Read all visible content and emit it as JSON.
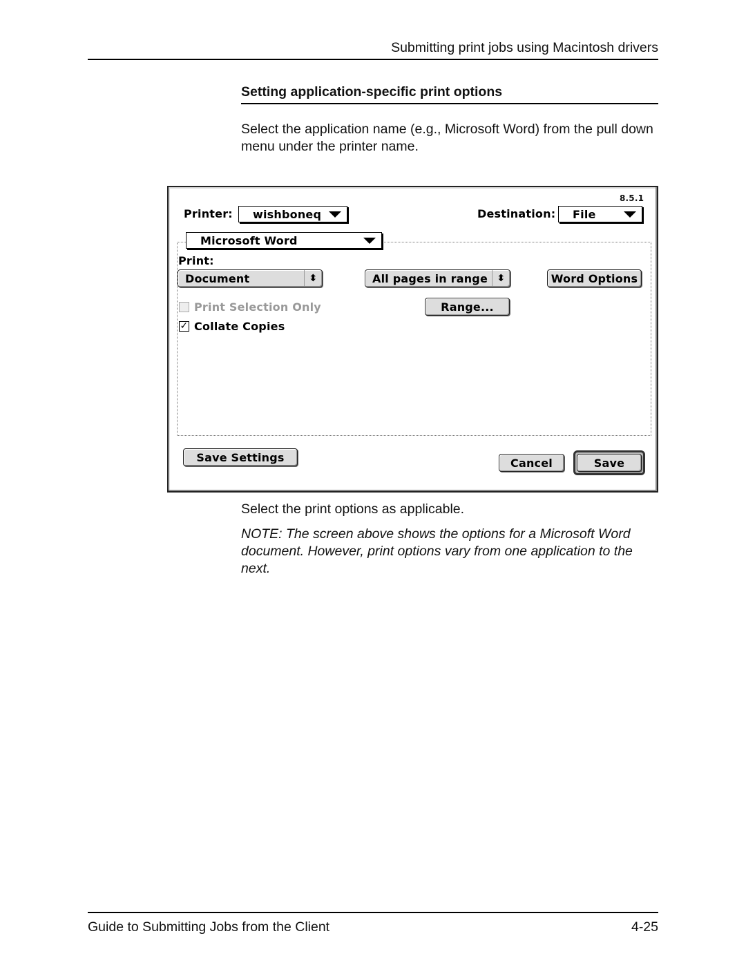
{
  "page": {
    "running_head": "Submitting print jobs using Macintosh drivers",
    "section_title": "Setting application-specific print options",
    "intro": "Select the application name (e.g., Microsoft Word) from the pull down menu under the printer name.",
    "after_dialog": "Select the print options as applicable.",
    "note": "NOTE:  The screen above shows the options for a Microsoft Word document. However, print options vary from one application to the next.",
    "footer_left": "Guide to Submitting Jobs from the Client",
    "footer_right": "4-25"
  },
  "dialog": {
    "version": "8.5.1",
    "printer_label": "Printer:",
    "printer_value": "wishboneq",
    "destination_label": "Destination:",
    "destination_value": "File",
    "panel_value": "Microsoft Word",
    "print_label": "Print:",
    "print_value": "Document",
    "pages_value": "All pages in range",
    "word_options_label": "Word Options",
    "range_label": "Range...",
    "print_selection_only": {
      "label": "Print Selection Only",
      "checked": false,
      "enabled": false
    },
    "collate_copies": {
      "label": "Collate Copies",
      "checked": true,
      "enabled": true
    },
    "save_settings_label": "Save Settings",
    "cancel_label": "Cancel",
    "save_label": "Save",
    "icons": {
      "popup_arrow": "▼",
      "stepper_arrows": "⬍",
      "checkmark": "✓"
    }
  }
}
